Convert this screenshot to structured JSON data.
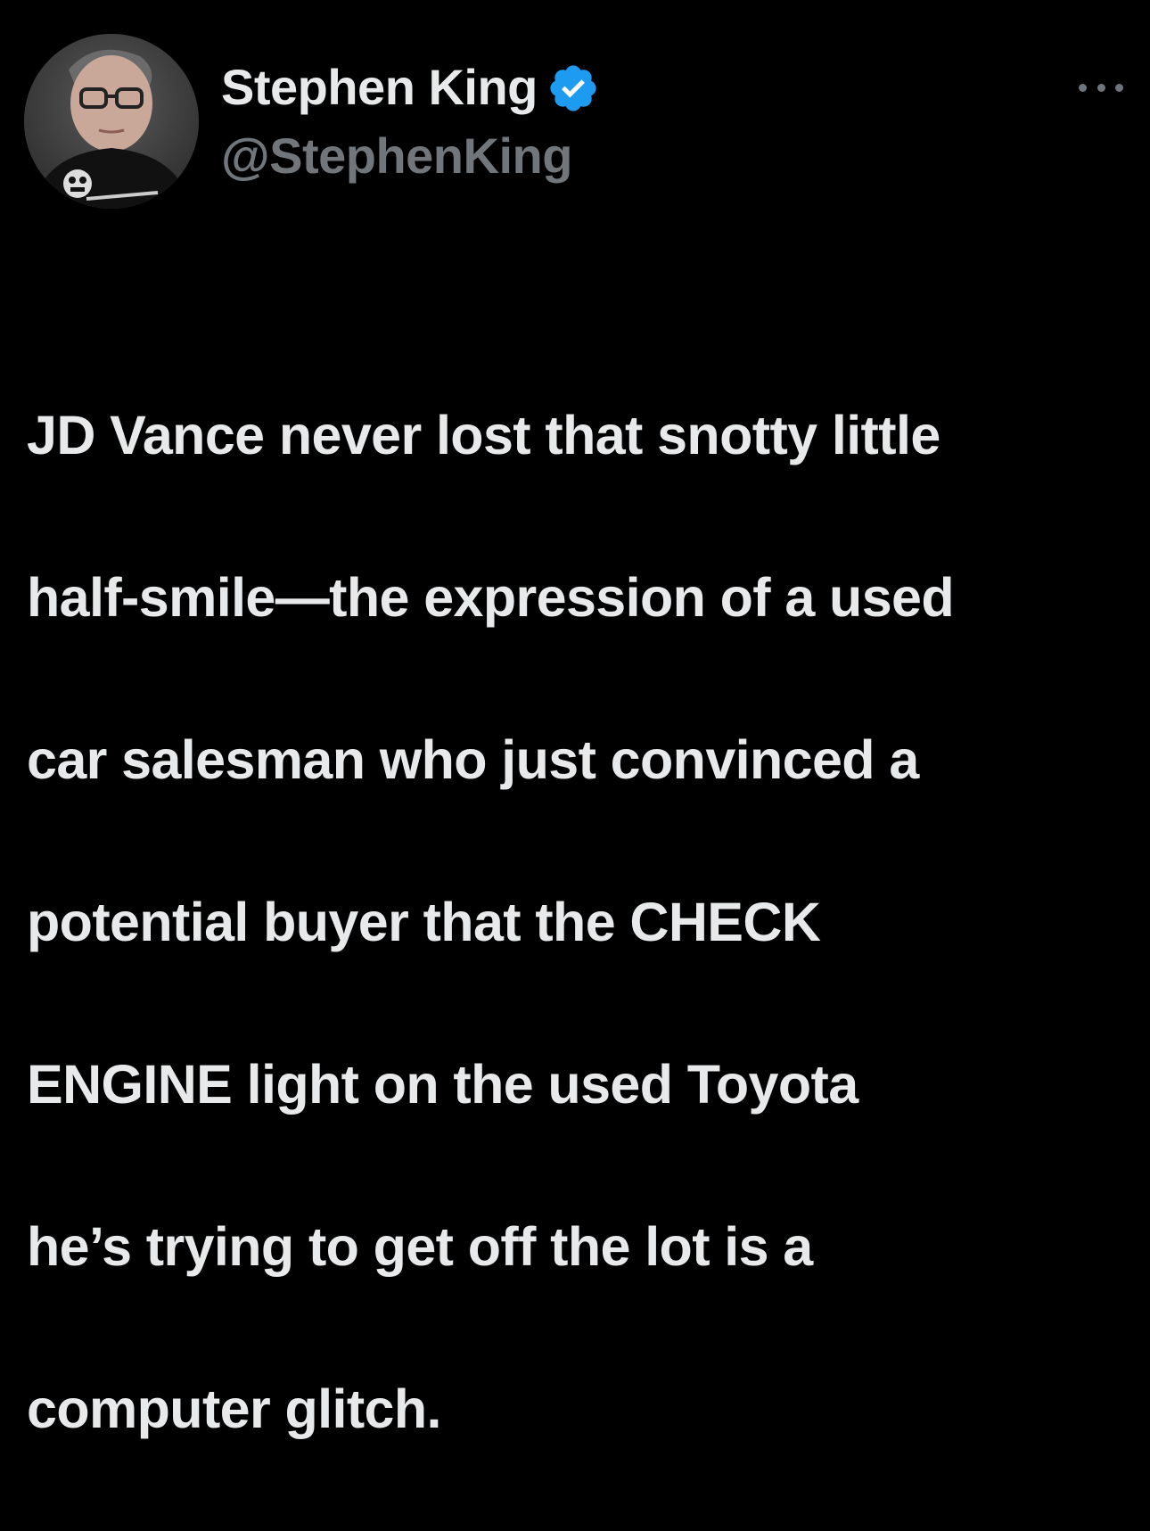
{
  "author": {
    "display_name": "Stephen King",
    "handle": "@StephenKing",
    "verified": true,
    "avatar_icon": "profile-photo"
  },
  "tweet": {
    "text_lines": [
      "JD Vance never lost that snotty little",
      "half-smile—the expression of a used",
      "car salesman who just convinced a",
      "potential buyer that the CHECK",
      "ENGINE light on the used Toyota",
      "he’s trying to get off the lot is a",
      "computer glitch."
    ]
  },
  "icons": {
    "more": "more-horizontal-icon",
    "verified": "verified-badge-icon"
  },
  "colors": {
    "background": "#000000",
    "text": "#e7e9ea",
    "secondary": "#71767b",
    "verified_blue": "#1d9bf0"
  }
}
